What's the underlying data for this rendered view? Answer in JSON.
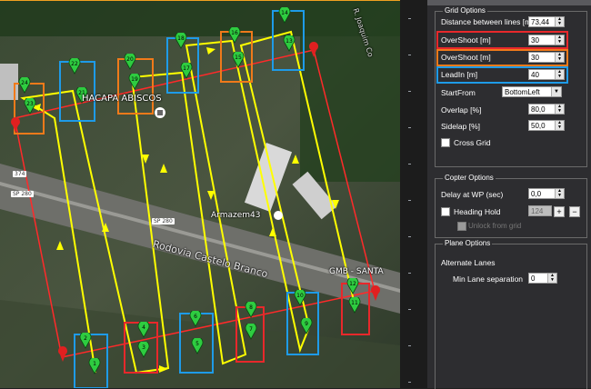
{
  "map": {
    "labels": {
      "place1": "HACAPA ABISCOS",
      "place2": "Armazem43",
      "road_main": "Rodovia Castelo Branco",
      "place3": "GMB - SANTA",
      "road_right": "R. Joaquim Co",
      "sp_280_a": "SP 280",
      "sp_280_b": "SP 280",
      "km_374": "374"
    },
    "waypoints": [
      "1",
      "2",
      "3",
      "4",
      "5",
      "6",
      "7",
      "8",
      "9",
      "10",
      "11",
      "12",
      "13",
      "14",
      "15",
      "16",
      "17",
      "18",
      "19",
      "20",
      "21",
      "22",
      "23",
      "24"
    ],
    "colors": {
      "grid_line": "#ffff00",
      "boundary": "#ff2a2a",
      "waypoint": "#2ecc40",
      "red_box": "#e8282b",
      "orange_box": "#f07a1a",
      "blue_box": "#1e9be8"
    }
  },
  "panel": {
    "grid_options": {
      "title": "Grid Options",
      "distance_label": "Distance between lines [m]",
      "distance_value": "73,44",
      "overshoot1_label": "OverShoot [m]",
      "overshoot1_value": "30",
      "overshoot2_label": "OverShoot [m]",
      "overshoot2_value": "30",
      "leadin_label": "LeadIn [m]",
      "leadin_value": "40",
      "startfrom_label": "StartFrom",
      "startfrom_value": "BottomLeft",
      "overlap_label": "Overlap [%]",
      "overlap_value": "80,0",
      "sidelap_label": "Sidelap [%]",
      "sidelap_value": "50,0",
      "crossgrid_label": "Cross Grid"
    },
    "copter_options": {
      "title": "Copter Options",
      "delay_label": "Delay at WP (sec)",
      "delay_value": "0,0",
      "heading_label": "Heading Hold",
      "heading_value": "124",
      "plus": "+",
      "minus": "−",
      "unlock_label": "Unlock from grid"
    },
    "plane_options": {
      "title": "Plane Options",
      "alternate_label": "Alternate Lanes",
      "min_lane_label": "Min Lane separation",
      "min_lane_value": "0"
    }
  }
}
